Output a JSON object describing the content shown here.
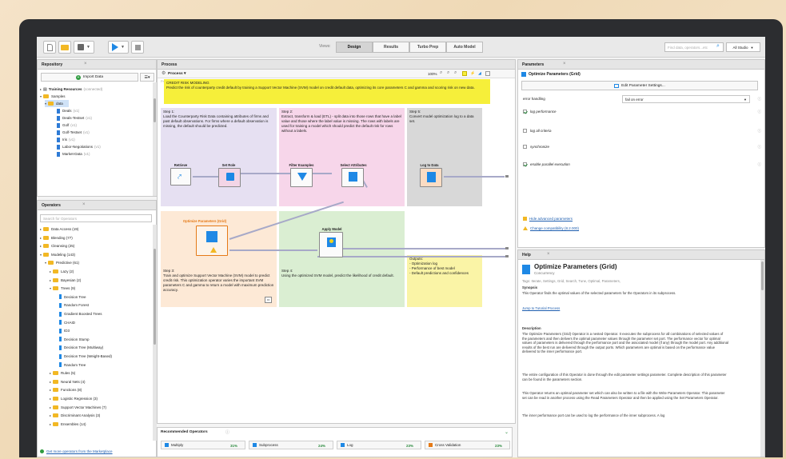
{
  "toolbar": {
    "views_label": "Views:",
    "tabs": [
      "Design",
      "Results",
      "Turbo Prep",
      "Auto Model"
    ],
    "search_placeholder": "Find data, operators...etc",
    "studio_label": "All Studio"
  },
  "repository": {
    "title": "Repository",
    "import_label": "Import Data",
    "items": [
      {
        "label": "Training Resources",
        "sub": "(connected)"
      },
      {
        "label": "Samples",
        "sub": ""
      },
      {
        "label": "data",
        "sub": ""
      },
      {
        "label": "Deals",
        "sub": "(v1)"
      },
      {
        "label": "Deals-Testset",
        "sub": "(v1)"
      },
      {
        "label": "Golf",
        "sub": "(v1)"
      },
      {
        "label": "Golf-Testset",
        "sub": "(v1)"
      },
      {
        "label": "Iris",
        "sub": "(v1)"
      },
      {
        "label": "Labor-Negotiations",
        "sub": "(v1)"
      },
      {
        "label": "Market-Data",
        "sub": "(v1)"
      }
    ]
  },
  "operators": {
    "title": "Operators",
    "search_placeholder": "Search for Operators",
    "items": [
      {
        "label": "Data Access (19)"
      },
      {
        "label": "Blending (77)"
      },
      {
        "label": "Cleansing (25)"
      },
      {
        "label": "Modeling (143)"
      },
      {
        "label": "Predictive (61)"
      },
      {
        "label": "Lazy (2)"
      },
      {
        "label": "Bayesian (2)"
      },
      {
        "label": "Trees (9)"
      },
      {
        "label": "Decision Tree"
      },
      {
        "label": "Random Forest"
      },
      {
        "label": "Gradient Boosted Trees"
      },
      {
        "label": "CHAID"
      },
      {
        "label": "ID3"
      },
      {
        "label": "Decision Stump"
      },
      {
        "label": "Decision Tree (Multiway)"
      },
      {
        "label": "Decision Tree (Weight-Based)"
      },
      {
        "label": "Random Tree"
      },
      {
        "label": "Rules (5)"
      },
      {
        "label": "Neural Nets (4)"
      },
      {
        "label": "Functions (8)"
      },
      {
        "label": "Logistic Regression (3)"
      },
      {
        "label": "Support Vector Machines (7)"
      },
      {
        "label": "Discriminant Analysis (3)"
      },
      {
        "label": "Ensembles (14)"
      }
    ],
    "marketplace_link": "Get more operators from the Marketplace"
  },
  "process": {
    "tab_title": "Process",
    "breadcrumb": "Process",
    "zoom": "100%",
    "canvas_label": "Process",
    "main_note": "CREDIT RISK MODELING\nPredict the risk of counterparty credit default by training a Support Vector Machine (SVM) model on credit default data, optimizing its core parameters C and gamma and scoring risk on new data.",
    "step1": "Step 1:\nLoad the Counterparty Risk Data containing attributes of firms and past default observations. For firms where a default observation is missing, the default should be predicted.",
    "step2": "Step 2:\nExtract, transform & load (ETL) - split data into those rows that have a label value and those where the label value is missing. The rows with labels are used for training a model which should predict the default risk for rows without a labels.",
    "step5": "Step 5:\nConvert model optimization log to a data set.",
    "step3": "Step 3:\nTrain and optimize Support Vector Machine (SVM) model to predict credit risk. This optimization operator varies the important SVM parameters C and gamma to return a model with maximum prediction accuracy.",
    "step4": "Step 4:\nUsing the optimized SVM model, predict the likelihood of credit default.",
    "outputs": "Outputs:\n- Optimization log\n- Performance of best model\n- Default predictions and confidences",
    "ops": {
      "retrieve": "Retrieve",
      "set_role": "Set Role",
      "filter_examples": "Filter Examples",
      "select_attributes": "Select Attributes",
      "log_to_data": "Log to Data",
      "optimize": "Optimize Parameters (Grid)",
      "apply_model": "Apply Model"
    }
  },
  "recommended": {
    "title": "Recommended Operators",
    "items": [
      {
        "label": "Multiply",
        "pct": "31%"
      },
      {
        "label": "Subprocess",
        "pct": "24%"
      },
      {
        "label": "Log",
        "pct": "23%"
      },
      {
        "label": "Cross Validation",
        "pct": "23%"
      }
    ]
  },
  "parameters": {
    "title": "Parameters",
    "operator_name": "Optimize Parameters (Grid)",
    "edit_button": "Edit Parameter Settings...",
    "error_handling_label": "error handling",
    "error_handling_value": "fail on error",
    "options": [
      {
        "label": "log performance",
        "checked": true
      },
      {
        "label": "log all criteria",
        "checked": false
      },
      {
        "label": "synchronize",
        "checked": false
      },
      {
        "label": "enable parallel execution",
        "checked": true
      }
    ],
    "hide_advanced": "Hide advanced parameters",
    "compatibility": "Change compatibility (8.2.000)"
  },
  "help": {
    "title": "Help",
    "operator_name": "Optimize Parameters (Grid)",
    "group": "Concurrency",
    "tags": "Tags: Iterate, Settings, Grid, Search, Tune, Optimal, Parameters,",
    "synopsis_heading": "Synopsis",
    "synopsis": "This Operator finds the optimal values of the selected parameters for the Operators in its subprocess.",
    "tutorial_link": "Jump to Tutorial Process",
    "description_heading": "Description",
    "description1": "The Optimize Parameters (Grid) Operator is a nested Operator. It executes the subprocess for all combinations of selected values of the parameters and then delivers the optimal parameter values through the parameter set port. The performance vector for optimal values of parameters is delivered through the performance port and the associated model (if any) through the model port. Any additional results of the best run are delivered through the output ports. Which parameters are optimal is based on the performance value delivered to the inner performance port.",
    "description2": "The entire configuration of this Operator is done through the edit parameter settings parameter. Complete description of this parameter can be found in the parameters section.",
    "description3": "This Operator returns an optimal parameter set which can also be written to a file with the Write Parameters Operator. This parameter set can be read in another process using the Read Parameters Operator and then be applied using the Set Parameters Operator.",
    "description4": "The inner performance port can be used to log the performance of the inner subprocess. A log"
  },
  "colors": {
    "accent_blue": "#1e88e5",
    "note_yellow": "#f6ef3a",
    "note_purple": "#e6e0f2",
    "note_pink": "#f7d6ea",
    "note_gray": "#d8d8d8",
    "note_orange": "#fde9d6",
    "note_green": "#daeed2",
    "note_lightyellow": "#faf4a6"
  }
}
